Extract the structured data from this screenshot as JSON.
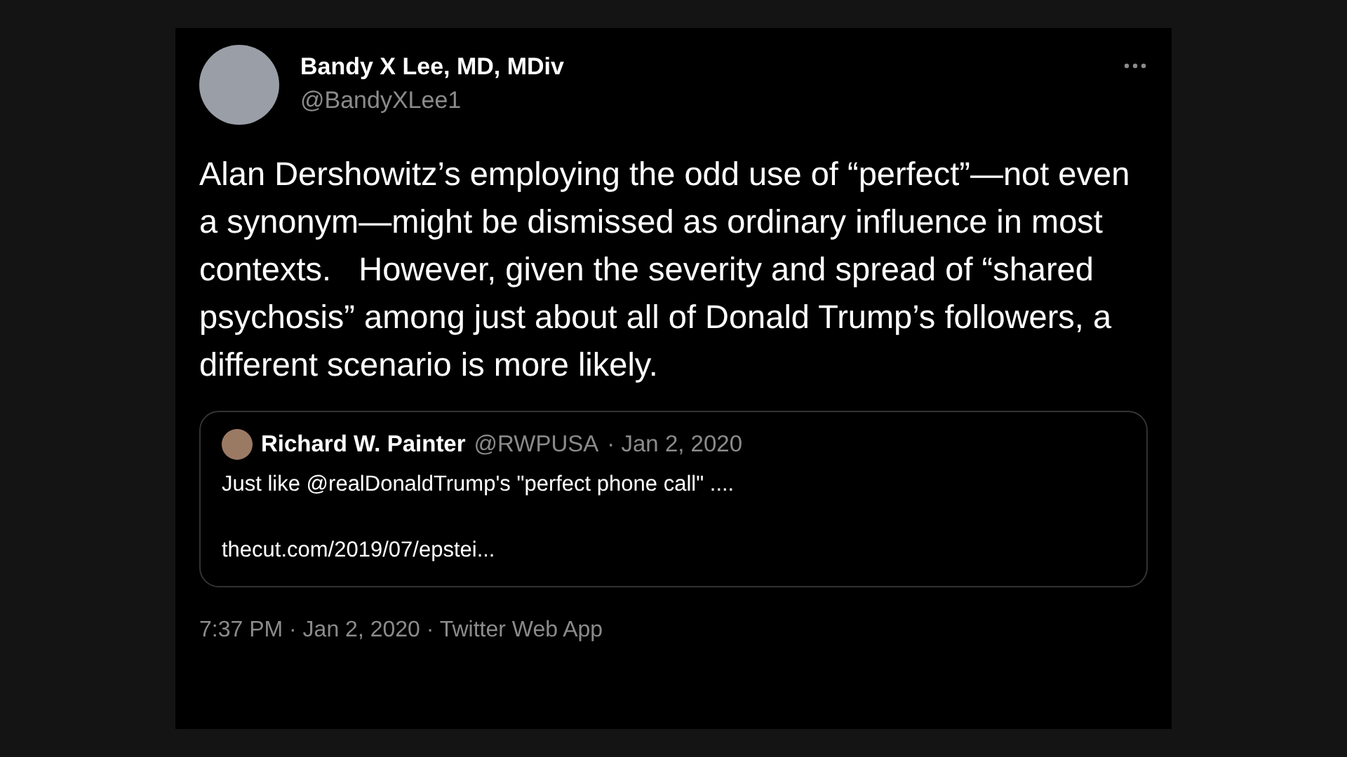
{
  "tweet": {
    "author": {
      "name": "Bandy X Lee, MD, MDiv",
      "handle": "@BandyXLee1"
    },
    "text": "Alan Dershowitz’s employing the odd use of “perfect”—not even a synonym—might be dismissed as ordinary influence in most contexts.   However, given the severity and spread of “shared psychosis” among just about all of Donald Trump’s followers, a different scenario is more likely.",
    "quoted_tweet": {
      "name": "Richard W. Painter",
      "handle": "@RWPUSA",
      "date": "· Jan 2, 2020",
      "text": "Just like @realDonaldTrump's \"perfect phone call\" ....",
      "link": "thecut.com/2019/07/epstei..."
    },
    "meta": "7:37 PM · Jan 2, 2020 · Twitter Web App"
  }
}
